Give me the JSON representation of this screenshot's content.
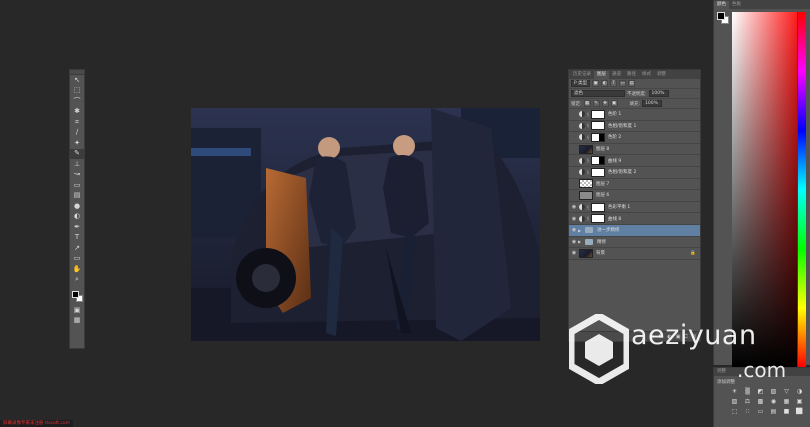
{
  "toolbar": {
    "tools": [
      {
        "name": "move-tool",
        "glyph": "↖"
      },
      {
        "name": "marquee-tool",
        "glyph": "⬚"
      },
      {
        "name": "lasso-tool",
        "glyph": "⌒"
      },
      {
        "name": "quick-select-tool",
        "glyph": "✱"
      },
      {
        "name": "crop-tool",
        "glyph": "⌗"
      },
      {
        "name": "eyedropper-tool",
        "glyph": "∕"
      },
      {
        "name": "healing-brush-tool",
        "glyph": "✦"
      },
      {
        "name": "brush-tool",
        "glyph": "✎"
      },
      {
        "name": "clone-stamp-tool",
        "glyph": "⊥"
      },
      {
        "name": "history-brush-tool",
        "glyph": "↝"
      },
      {
        "name": "eraser-tool",
        "glyph": "▭"
      },
      {
        "name": "gradient-tool",
        "glyph": "▤"
      },
      {
        "name": "blur-tool",
        "glyph": "●"
      },
      {
        "name": "dodge-tool",
        "glyph": "◐"
      },
      {
        "name": "pen-tool",
        "glyph": "✒"
      },
      {
        "name": "type-tool",
        "glyph": "T"
      },
      {
        "name": "path-select-tool",
        "glyph": "↗"
      },
      {
        "name": "shape-tool",
        "glyph": "▭"
      },
      {
        "name": "hand-tool",
        "glyph": "✋"
      },
      {
        "name": "zoom-tool",
        "glyph": "⌕"
      }
    ],
    "quick_mask_glyph": "▣",
    "screen_mode_glyph": "▦"
  },
  "layers_panel": {
    "tabs": [
      "历史记录",
      "图层",
      "通道",
      "路径",
      "样式",
      "调整"
    ],
    "active_tab": "图层",
    "filter_kind": "P 类型",
    "blend_mode": "滤色",
    "opacity_label": "不透明度:",
    "opacity_value": "100%",
    "lock_label": "锁定:",
    "fill_label": "填充:",
    "fill_value": "100%",
    "layers": [
      {
        "name": "色阶 1",
        "visible": false,
        "kind": "adjustment",
        "thumb": "white",
        "selected": false
      },
      {
        "name": "色相/饱和度 1",
        "visible": false,
        "kind": "adjustment",
        "thumb": "white",
        "selected": false
      },
      {
        "name": "色阶 2",
        "visible": false,
        "kind": "adjustment",
        "thumb": "mask",
        "selected": false
      },
      {
        "name": "图层 8",
        "visible": false,
        "kind": "pixel",
        "thumb": "dark",
        "selected": false
      },
      {
        "name": "曲线 9",
        "visible": false,
        "kind": "adjustment",
        "thumb": "mask",
        "selected": false
      },
      {
        "name": "色相/饱和度 2",
        "visible": false,
        "kind": "adjustment",
        "thumb": "white",
        "selected": false
      },
      {
        "name": "图层 7",
        "visible": false,
        "kind": "pixel",
        "thumb": "checker",
        "selected": false
      },
      {
        "name": "图层 6",
        "visible": false,
        "kind": "pixel",
        "thumb": "gray",
        "selected": false
      },
      {
        "name": "色彩平衡 1",
        "visible": true,
        "kind": "adjustment",
        "thumb": "white",
        "selected": false
      },
      {
        "name": "曲线 8",
        "visible": true,
        "kind": "adjustment",
        "thumb": "white",
        "selected": false
      },
      {
        "name": "进一步精修",
        "visible": true,
        "kind": "group",
        "thumb": "folder",
        "selected": true
      },
      {
        "name": "精修",
        "visible": true,
        "kind": "group",
        "thumb": "folder",
        "selected": false
      },
      {
        "name": "背景",
        "visible": true,
        "kind": "background",
        "thumb": "dark",
        "selected": false
      }
    ],
    "bottom_icons": [
      "⚭",
      "fx",
      "◐",
      "▣",
      "⎕",
      "☒"
    ]
  },
  "color_panel": {
    "tabs": [
      "颜色",
      "色板"
    ],
    "active_tab": "颜色",
    "foreground": "#000000",
    "background": "#ffffff"
  },
  "adjustments_panel": {
    "tab": "调整",
    "title": "添加调整",
    "icons": [
      "☀",
      "▒",
      "◩",
      "▧",
      "▽",
      "◑",
      "▨",
      "⚖",
      "▩",
      "◉",
      "▦",
      "▣",
      "⬚",
      "∷",
      "▭",
      "▤",
      "■",
      "⬜"
    ]
  },
  "watermark": {
    "text": "aeziyuan",
    "domain": ".com"
  },
  "footer": {
    "note": "屏幕录像专家未注册 tlxsoft.com"
  },
  "colors": {
    "workspace": "#282828",
    "panel": "#535353",
    "selected_layer": "#5f7fa3",
    "footer_text": "#e03030"
  }
}
